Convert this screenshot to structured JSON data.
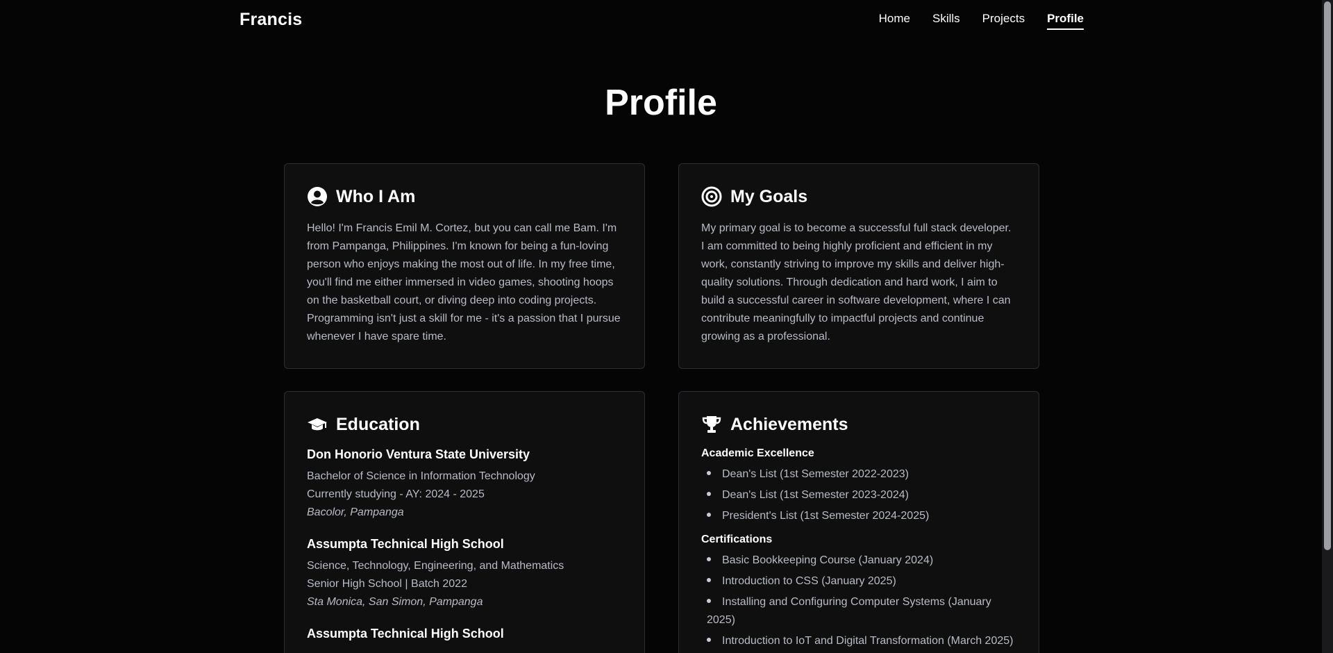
{
  "header": {
    "brand": "Francis",
    "nav": [
      {
        "label": "Home",
        "active": false
      },
      {
        "label": "Skills",
        "active": false
      },
      {
        "label": "Projects",
        "active": false
      },
      {
        "label": "Profile",
        "active": true
      }
    ]
  },
  "page_title": "Profile",
  "who": {
    "icon": "user-circle-icon",
    "title": "Who I Am",
    "text": "Hello! I'm Francis Emil M. Cortez, but you can call me Bam. I'm from Pampanga, Philippines. I'm known for being a fun-loving person who enjoys making the most out of life. In my free time, you'll find me either immersed in video games, shooting hoops on the basketball court, or diving deep into coding projects. Programming isn't just a skill for me - it's a passion that I pursue whenever I have spare time."
  },
  "goals": {
    "icon": "target-icon",
    "title": "My Goals",
    "text": "My primary goal is to become a successful full stack developer. I am committed to being highly proficient and efficient in my work, constantly striving to improve my skills and deliver high-quality solutions. Through dedication and hard work, I aim to build a successful career in software development, where I can contribute meaningfully to impactful projects and continue growing as a professional."
  },
  "education": {
    "icon": "graduation-cap-icon",
    "title": "Education",
    "items": [
      {
        "school": "Don Honorio Ventura State University",
        "line1": "Bachelor of Science in Information Technology",
        "line2": "Currently studying - AY: 2024 - 2025",
        "location": "Bacolor, Pampanga"
      },
      {
        "school": "Assumpta Technical High School",
        "line1": "Science, Technology, Engineering, and Mathematics",
        "line2": "Senior High School | Batch 2022",
        "location": "Sta Monica, San Simon, Pampanga"
      },
      {
        "school": "Assumpta Technical High School"
      }
    ]
  },
  "achievements": {
    "icon": "trophy-icon",
    "title": "Achievements",
    "academic_title": "Academic Excellence",
    "academic": [
      "Dean's List (1st Semester 2022-2023)",
      "Dean's List (1st Semester 2023-2024)",
      "President's List (1st Semester 2024-2025)"
    ],
    "cert_title": "Certifications",
    "certs": [
      "Basic Bookkeeping Course (January 2024)",
      "Introduction to CSS (January 2025)",
      "Installing and Configuring Computer Systems (January 2025)",
      "Introduction to IoT and Digital Transformation (March 2025)"
    ]
  }
}
